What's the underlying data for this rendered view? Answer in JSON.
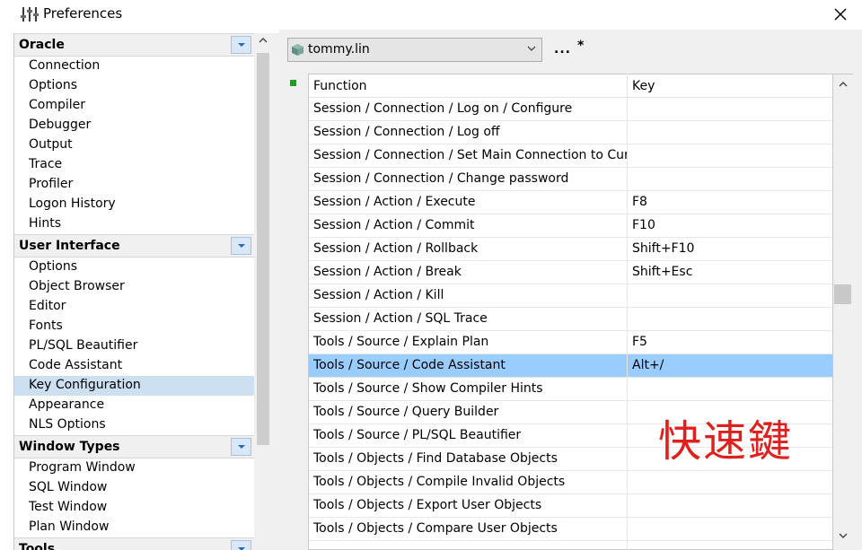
{
  "window": {
    "title": "Preferences"
  },
  "icons": {
    "app": "preferences-sliders-icon",
    "close": "close-icon",
    "database": "database-icon"
  },
  "sidebar": {
    "groups": [
      {
        "title": "Oracle",
        "items": [
          "Connection",
          "Options",
          "Compiler",
          "Debugger",
          "Output",
          "Trace",
          "Profiler",
          "Logon History",
          "Hints"
        ]
      },
      {
        "title": "User Interface",
        "items": [
          "Options",
          "Object Browser",
          "Editor",
          "Fonts",
          "PL/SQL Beautifier",
          "Code Assistant",
          "Key Configuration",
          "Appearance",
          "NLS Options"
        ]
      },
      {
        "title": "Window Types",
        "items": [
          "Program Window",
          "SQL Window",
          "Test Window",
          "Plan Window"
        ]
      },
      {
        "title": "Tools",
        "items": []
      }
    ],
    "selected": "Key Configuration"
  },
  "toolbar": {
    "user": "tommy.lin",
    "ellipsis": "...",
    "modified": "*"
  },
  "grid": {
    "headers": {
      "function": "Function",
      "key": "Key"
    },
    "rows": [
      {
        "fn": "Session / Connection / Log on / Configure",
        "key": ""
      },
      {
        "fn": "Session / Connection / Log off",
        "key": ""
      },
      {
        "fn": "Session / Connection / Set Main Connection to Current",
        "key": ""
      },
      {
        "fn": "Session / Connection / Change password",
        "key": ""
      },
      {
        "fn": "Session / Action / Execute",
        "key": "F8"
      },
      {
        "fn": "Session / Action / Commit",
        "key": "F10"
      },
      {
        "fn": "Session / Action / Rollback",
        "key": "Shift+F10"
      },
      {
        "fn": "Session / Action / Break",
        "key": "Shift+Esc"
      },
      {
        "fn": "Session / Action / Kill",
        "key": ""
      },
      {
        "fn": "Session / Action / SQL Trace",
        "key": ""
      },
      {
        "fn": "Tools / Source / Explain Plan",
        "key": "F5"
      },
      {
        "fn": "Tools / Source / Code Assistant",
        "key": "Alt+/"
      },
      {
        "fn": "Tools / Source / Show Compiler Hints",
        "key": ""
      },
      {
        "fn": "Tools / Source / Query Builder",
        "key": ""
      },
      {
        "fn": "Tools / Source / PL/SQL Beautifier",
        "key": ""
      },
      {
        "fn": "Tools / Objects / Find Database Objects",
        "key": ""
      },
      {
        "fn": "Tools / Objects / Compile Invalid Objects",
        "key": ""
      },
      {
        "fn": "Tools / Objects / Export User Objects",
        "key": ""
      },
      {
        "fn": "Tools / Objects / Compare User Objects",
        "key": ""
      }
    ],
    "selected_index": 11
  },
  "annotation": {
    "text": "快速鍵",
    "color": "#e0201c"
  },
  "colors": {
    "selection": "#99ccff",
    "sidebar_selection": "#cce0f2",
    "marker": "#18a218"
  }
}
